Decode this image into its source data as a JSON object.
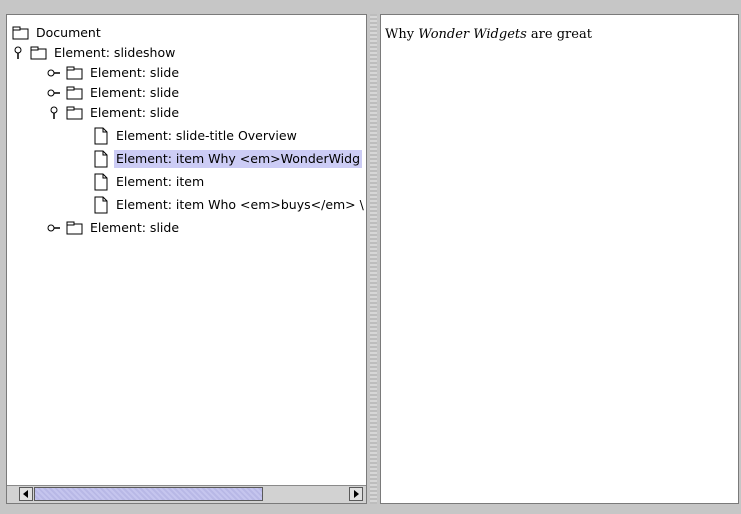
{
  "tree": {
    "nodes": [
      {
        "label": "Document",
        "type": "folder",
        "toggle": "none"
      },
      {
        "label": "Element: slideshow",
        "type": "folder",
        "toggle": "expanded"
      },
      {
        "label": "Element: slide",
        "type": "folder",
        "toggle": "collapsed"
      },
      {
        "label": "Element: slide",
        "type": "folder",
        "toggle": "collapsed"
      },
      {
        "label": "Element: slide",
        "type": "folder",
        "toggle": "expanded"
      },
      {
        "label": "Element: slide-title Overview",
        "type": "leaf",
        "toggle": "none"
      },
      {
        "label": "Element: item Why <em>WonderWidg",
        "type": "leaf",
        "toggle": "none",
        "selected": true
      },
      {
        "label": "Element: item",
        "type": "leaf",
        "toggle": "none"
      },
      {
        "label": "Element: item Who <em>buys</em> \\",
        "type": "leaf",
        "toggle": "none"
      },
      {
        "label": "Element: slide",
        "type": "folder",
        "toggle": "collapsed"
      }
    ]
  },
  "content": {
    "prefix": "Why ",
    "emphasis": "Wonder Widgets",
    "suffix": " are great"
  },
  "colors": {
    "selection": "#ccccf5",
    "background": "#c6c6c6"
  }
}
